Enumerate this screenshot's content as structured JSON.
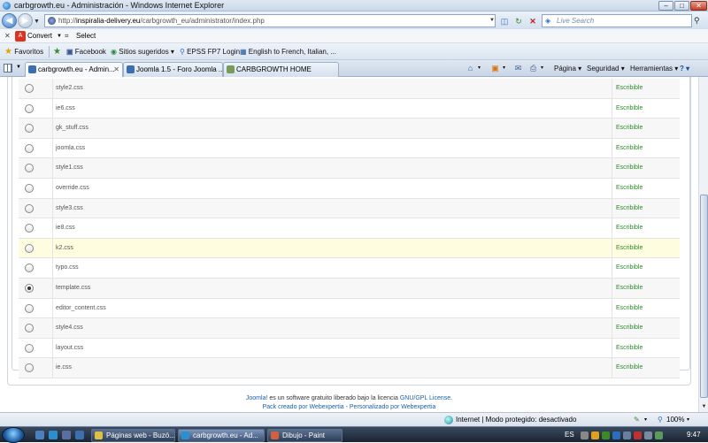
{
  "window": {
    "title": "carbgrowth.eu - Administración - Windows Internet Explorer",
    "min": "–",
    "max": "□",
    "close": "✕"
  },
  "address": {
    "back": "◀",
    "forward": "▶",
    "nav_dropdown": "▼",
    "url_prefix": "http://",
    "url_domain": "inspiralia-delivery.eu",
    "url_path": "/carbgrowth_eu/administrator/index.php",
    "url_dropdown": "▼",
    "compat": "◫",
    "refresh": "↻",
    "stop": "✕",
    "search_placeholder": "Live Search",
    "search_go": "⚲"
  },
  "convert_bar": {
    "close": "✕",
    "convert_icon": "A",
    "convert": "Convert",
    "dropdown": "▼",
    "select_icon": "⌗",
    "select": "Select"
  },
  "favorites": {
    "label": "Favoritos",
    "items": [
      "Facebook",
      "Sitios sugeridos ▾",
      "EPSS FP7 Login",
      "English to French, Italian, ..."
    ]
  },
  "tabs": {
    "list_dropdown": "▼",
    "items": [
      {
        "label": "carbgrowth.eu - Admin...",
        "close": "✕"
      },
      {
        "label": "Joomla 1.5 - Foro Joomla ..."
      },
      {
        "label": "CARBGROWTH HOME"
      }
    ]
  },
  "commands": {
    "home_drop": "▾",
    "feeds_drop": "▾",
    "print_drop": "▾",
    "page": "Página ▾",
    "safety": "Seguridad ▾",
    "tools": "Herramientas ▾",
    "help": "? ▾"
  },
  "files": [
    {
      "name": "style2.css",
      "status": "Escribible",
      "selected": false
    },
    {
      "name": "ie6.css",
      "status": "Escribible",
      "selected": false
    },
    {
      "name": "gk_stuff.css",
      "status": "Escribible",
      "selected": false
    },
    {
      "name": "joomla.css",
      "status": "Escribible",
      "selected": false
    },
    {
      "name": "style1.css",
      "status": "Escribible",
      "selected": false
    },
    {
      "name": "override.css",
      "status": "Escribible",
      "selected": false
    },
    {
      "name": "style3.css",
      "status": "Escribible",
      "selected": false
    },
    {
      "name": "ie8.css",
      "status": "Escribible",
      "selected": false
    },
    {
      "name": "k2.css",
      "status": "Escribible",
      "selected": false
    },
    {
      "name": "typo.css",
      "status": "Escribible",
      "selected": false
    },
    {
      "name": "template.css",
      "status": "Escribible",
      "selected": true
    },
    {
      "name": "editor_content.css",
      "status": "Escribible",
      "selected": false
    },
    {
      "name": "style4.css",
      "status": "Escribible",
      "selected": false
    },
    {
      "name": "layout.css",
      "status": "Escribible",
      "selected": false
    },
    {
      "name": "ie.css",
      "status": "Escribible",
      "selected": false
    }
  ],
  "footer": {
    "joomla": "Joomla!",
    "line1_mid": " es un software gratuito liberado bajo la licencia ",
    "license": "GNU/GPL License",
    "line1_end": ".",
    "line2_a": "Pack creado por ",
    "webexpertia": "Webexpertia",
    "line2_b": " - Personalizado por ",
    "webexpertia2": "Webexpertia"
  },
  "scrollbar": {
    "down": "▼"
  },
  "status": {
    "zone": "Internet | Modo protegido: desactivado",
    "zoom": "100%",
    "zoom_drop": "▾",
    "zone_drop": "▾"
  },
  "taskbar": {
    "tasks": [
      "Páginas web - Buzó...",
      "carbgrowth.eu - Ad...",
      "Dibujo - Paint"
    ],
    "lang": "ES",
    "time": "9:47"
  }
}
